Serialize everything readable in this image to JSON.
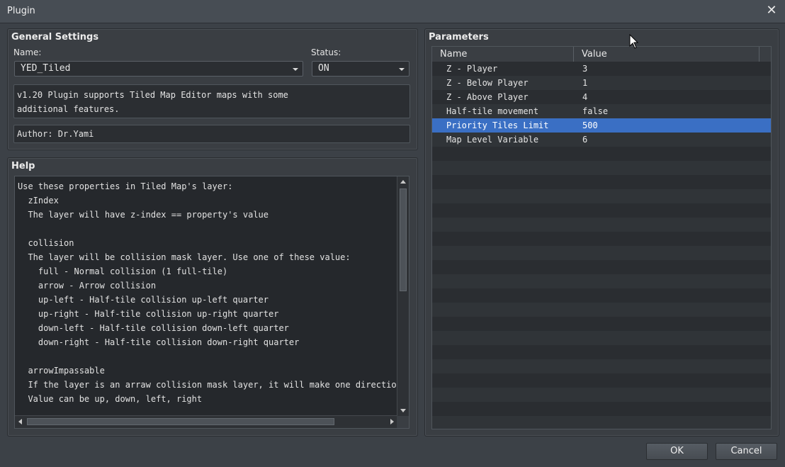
{
  "window": {
    "title": "Plugin",
    "close_glyph": "✕"
  },
  "general": {
    "title": "General Settings",
    "name_label": "Name:",
    "name_value": "YED_Tiled",
    "status_label": "Status:",
    "status_value": "ON",
    "description": "v1.20 Plugin supports Tiled Map Editor maps with some additional features.",
    "author": "Author: Dr.Yami"
  },
  "help": {
    "title": "Help",
    "lines": [
      "Use these properties in Tiled Map's layer:",
      "  zIndex",
      "  The layer will have z-index == property's value",
      "",
      "  collision",
      "  The layer will be collision mask layer. Use one of these value:",
      "    full - Normal collision (1 full-tile)",
      "    arrow - Arrow collision",
      "    up-left - Half-tile collision up-left quarter",
      "    up-right - Half-tile collision up-right quarter",
      "    down-left - Half-tile collision down-left quarter",
      "    down-right - Half-tile collision down-right quarter",
      "",
      "  arrowImpassable",
      "  If the layer is an arraw collision mask layer, it will make one direction be",
      "  Value can be up, down, left, right"
    ]
  },
  "parameters": {
    "title": "Parameters",
    "columns": [
      "Name",
      "Value"
    ],
    "rows": [
      {
        "name": "Z - Player",
        "value": "3"
      },
      {
        "name": "Z - Below Player",
        "value": "1"
      },
      {
        "name": "Z - Above Player",
        "value": "4"
      },
      {
        "name": "Half-tile movement",
        "value": "false"
      },
      {
        "name": "Priority Tiles Limit",
        "value": "500",
        "selected": true
      },
      {
        "name": "Map Level Variable",
        "value": "6"
      }
    ],
    "selection_color": "#3a6fc4"
  },
  "buttons": {
    "ok": "OK",
    "cancel": "Cancel"
  }
}
